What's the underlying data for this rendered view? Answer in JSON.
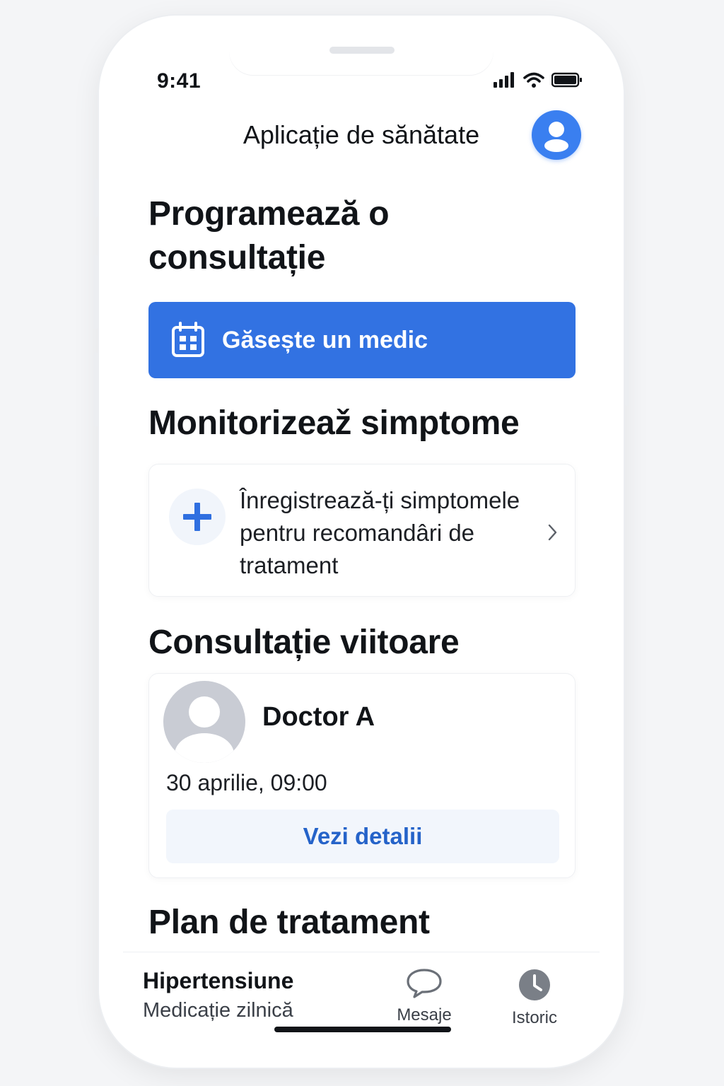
{
  "status_bar": {
    "time": "9:41"
  },
  "header": {
    "title": "Aplicație de sănătate",
    "profile_icon": "user-icon"
  },
  "sections": {
    "schedule_title": "Programează o consultație",
    "symptoms_title": "Monitorizeaž simptome",
    "upcoming_title": "Consultație viitoare",
    "plan_title": "Plan de tratament"
  },
  "find_doctor_button": {
    "label": "Găsește un medic",
    "icon": "calendar-icon"
  },
  "symptom_card": {
    "text": "Înregistrează-ți simptomele pentru recomandâri de tratament",
    "icon": "plus-icon"
  },
  "appointment": {
    "doctor": "Doctor A",
    "date": "30 aprilie, 09:00",
    "details_label": "Vezi detalii"
  },
  "bottom_bar": {
    "plan_item_title": "Hipertensiune",
    "plan_item_subtitle": "Medicație zilnică",
    "tabs": [
      {
        "label": "Mesaje",
        "icon": "chat-bubble-icon"
      },
      {
        "label": "Istoric",
        "icon": "clock-icon"
      }
    ]
  },
  "colors": {
    "primary": "#3272e2",
    "avatar_blue": "#3a7ff0",
    "link": "#2563c9"
  }
}
